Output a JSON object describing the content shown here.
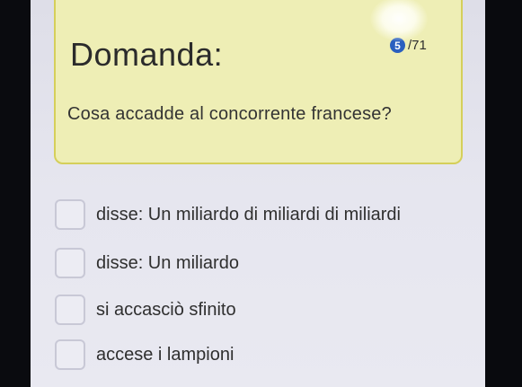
{
  "question": {
    "title": "Domanda:",
    "current": "5",
    "total": "/71",
    "text": "Cosa accadde al concorrente francese?"
  },
  "answers": [
    {
      "label": "disse: Un miliardo di miliardi di miliardi"
    },
    {
      "label": "disse: Un miliardo"
    },
    {
      "label": "si accasciò sfinito"
    },
    {
      "label": "accese i lampioni"
    }
  ],
  "colors": {
    "card_background": "#eeeeb5",
    "card_border": "#d5cf5a",
    "counter_badge": "#2a5fbf",
    "screen_background": "#e6e6ef"
  }
}
